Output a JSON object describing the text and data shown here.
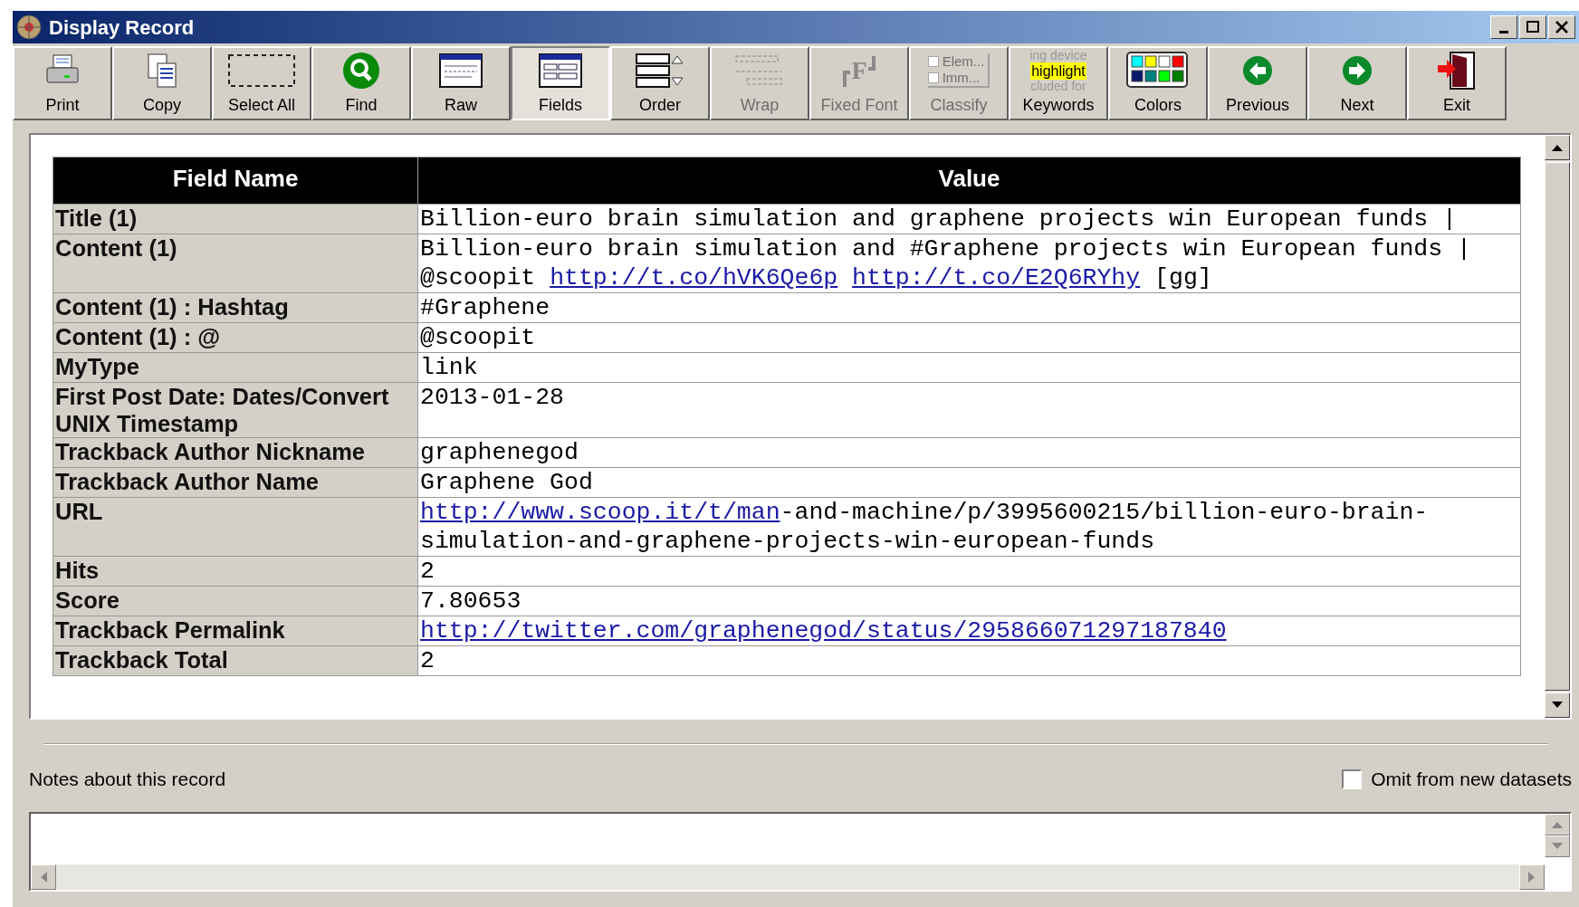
{
  "window": {
    "title": "Display Record"
  },
  "toolbar": [
    {
      "kind": "print",
      "label": "Print",
      "selected": false,
      "disabled": false
    },
    {
      "kind": "copy",
      "label": "Copy",
      "selected": false,
      "disabled": false
    },
    {
      "kind": "selectall",
      "label": "Select All",
      "selected": false,
      "disabled": false
    },
    {
      "kind": "find",
      "label": "Find",
      "selected": false,
      "disabled": false
    },
    {
      "kind": "raw",
      "label": "Raw",
      "selected": false,
      "disabled": false
    },
    {
      "kind": "fields",
      "label": "Fields",
      "selected": true,
      "disabled": false
    },
    {
      "kind": "order",
      "label": "Order",
      "selected": false,
      "disabled": false
    },
    {
      "kind": "wrap",
      "label": "Wrap",
      "selected": false,
      "disabled": true
    },
    {
      "kind": "fixedfont",
      "label": "Fixed Font",
      "selected": false,
      "disabled": true,
      "icon_text": [
        "F"
      ]
    },
    {
      "kind": "classify",
      "label": "Classify",
      "selected": false,
      "disabled": true,
      "icon_text": [
        "Elem...",
        "Imm..."
      ]
    },
    {
      "kind": "keywords",
      "label": "Keywords",
      "selected": false,
      "disabled": false,
      "icon_text": [
        "ing device",
        "highlight",
        "cluded for"
      ]
    },
    {
      "kind": "colors",
      "label": "Colors",
      "selected": false,
      "disabled": false
    },
    {
      "kind": "previous",
      "label": "Previous",
      "selected": false,
      "disabled": false
    },
    {
      "kind": "next",
      "label": "Next",
      "selected": false,
      "disabled": false
    },
    {
      "kind": "exit",
      "label": "Exit",
      "selected": false,
      "disabled": false
    }
  ],
  "table": {
    "columns": [
      "Field Name",
      "Value"
    ],
    "rows": [
      {
        "field": "Title (1)",
        "value": [
          {
            "text": "Billion-euro brain simulation and graphene projects win European funds |",
            "link": false
          }
        ]
      },
      {
        "field": "Content (1)",
        "value": [
          {
            "text": "Billion-euro brain simulation and #Graphene projects win European funds | @scoopit",
            "link": false,
            "space_after": true
          },
          {
            "text": "http://t.co/hVK6Qe6p",
            "link": true,
            "space_after": true
          },
          {
            "text": "http://t.co/E2Q6RYhy",
            "link": true,
            "space_after": true
          },
          {
            "text": "[gg]",
            "link": false
          }
        ]
      },
      {
        "field": "Content (1) : Hashtag",
        "value": [
          {
            "text": "#Graphene",
            "link": false
          }
        ]
      },
      {
        "field": "Content (1) : @",
        "value": [
          {
            "text": "@scoopit",
            "link": false
          }
        ]
      },
      {
        "field": "MyType",
        "value": [
          {
            "text": "link",
            "link": false
          }
        ]
      },
      {
        "field": "First Post Date: Dates/Convert UNIX Timestamp",
        "value": [
          {
            "text": "2013-01-28",
            "link": false
          }
        ]
      },
      {
        "field": "Trackback Author Nickname",
        "value": [
          {
            "text": "graphenegod",
            "link": false
          }
        ]
      },
      {
        "field": "Trackback Author Name",
        "value": [
          {
            "text": "Graphene God",
            "link": false
          }
        ]
      },
      {
        "field": "URL",
        "value": [
          {
            "text": "http://www.scoop.it/t/man",
            "link": true
          },
          {
            "text": "-and-machine/p/3995600215/billion-euro-brain-simulation-and-graphene-projects-win-european-funds",
            "link": false
          }
        ]
      },
      {
        "field": "Hits",
        "value": [
          {
            "text": "2",
            "link": false
          }
        ]
      },
      {
        "field": "Score",
        "value": [
          {
            "text": "7.80653",
            "link": false
          }
        ]
      },
      {
        "field": "Trackback Permalink",
        "value": [
          {
            "text": "http://twitter.com/graphenegod/status/295866071297187840",
            "link": true
          }
        ]
      },
      {
        "field": "Trackback Total",
        "value": [
          {
            "text": "2",
            "link": false
          }
        ]
      }
    ]
  },
  "notes": {
    "label": "Notes about this record"
  },
  "omit": {
    "label": "Omit from new datasets",
    "checked": false
  }
}
